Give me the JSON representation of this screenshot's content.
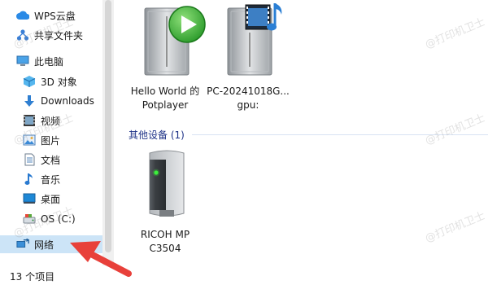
{
  "nav": {
    "items": [
      {
        "label": "WPS云盘",
        "icon": "cloud-icon"
      },
      {
        "label": "共享文件夹",
        "icon": "share-folder-icon"
      },
      {
        "label": "此电脑",
        "icon": "computer-icon"
      },
      {
        "label": "3D 对象",
        "icon": "3d-objects-icon"
      },
      {
        "label": "Downloads",
        "icon": "download-icon"
      },
      {
        "label": "视频",
        "icon": "video-icon"
      },
      {
        "label": "图片",
        "icon": "picture-icon"
      },
      {
        "label": "文档",
        "icon": "document-icon"
      },
      {
        "label": "音乐",
        "icon": "music-icon"
      },
      {
        "label": "桌面",
        "icon": "desktop-icon"
      },
      {
        "label": "OS (C:)",
        "icon": "drive-icon"
      },
      {
        "label": "网络",
        "icon": "network-icon",
        "selected": true
      }
    ]
  },
  "content": {
    "items": [
      {
        "label": "Hello World 的\nPotplayer",
        "icon": "media-server-play-icon"
      },
      {
        "label": "PC-20241018G...\ngpu:",
        "icon": "media-server-music-icon"
      }
    ],
    "group": {
      "title": "其他设备 (1)"
    },
    "devices": [
      {
        "label": "RICOH MP\nC3504",
        "icon": "printer-device-icon"
      }
    ]
  },
  "status": {
    "item_count": "13 个项目"
  },
  "watermark": {
    "text": "@打印机卫士"
  },
  "colors": {
    "selected_bg": "#cce4f7",
    "group_header": "#1e3287",
    "arrow": "#e8403a"
  }
}
